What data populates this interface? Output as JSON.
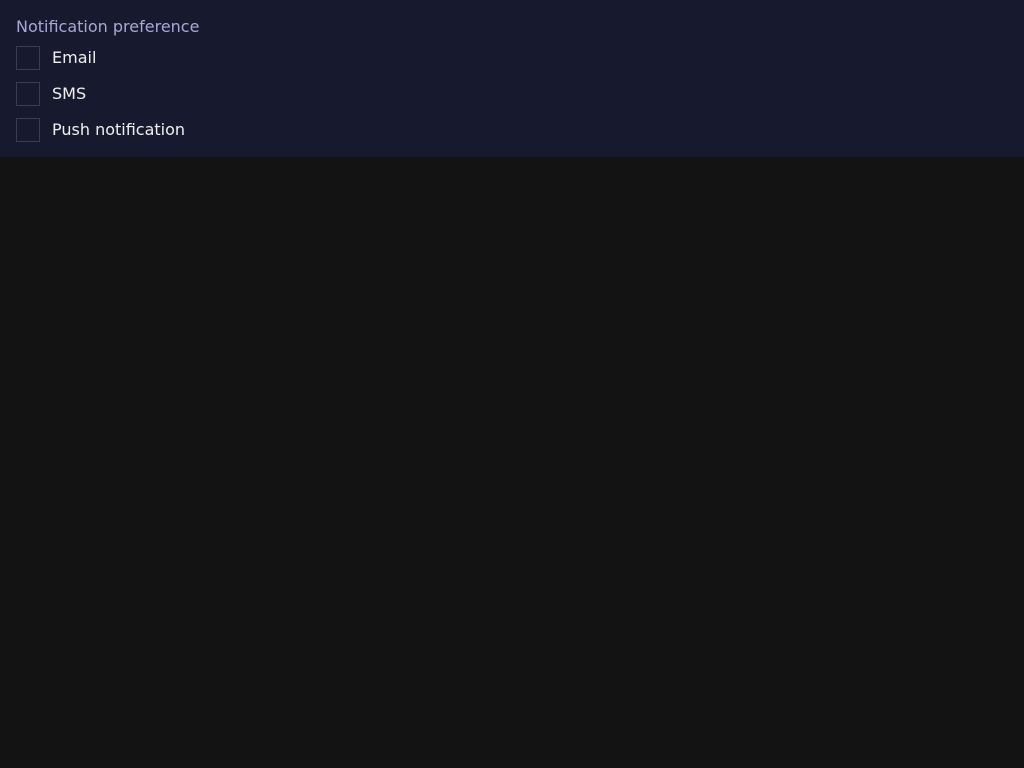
{
  "notification": {
    "label": "Notification preference",
    "options": [
      {
        "label": "Email",
        "checked": false
      },
      {
        "label": "SMS",
        "checked": false
      },
      {
        "label": "Push notification",
        "checked": false
      }
    ]
  },
  "colors": {
    "panel_background": "#171a2e",
    "page_background": "#131313",
    "label_text": "#a8a8d8",
    "option_text": "#f0f0f0",
    "checkbox_border": "#3a3d52"
  }
}
